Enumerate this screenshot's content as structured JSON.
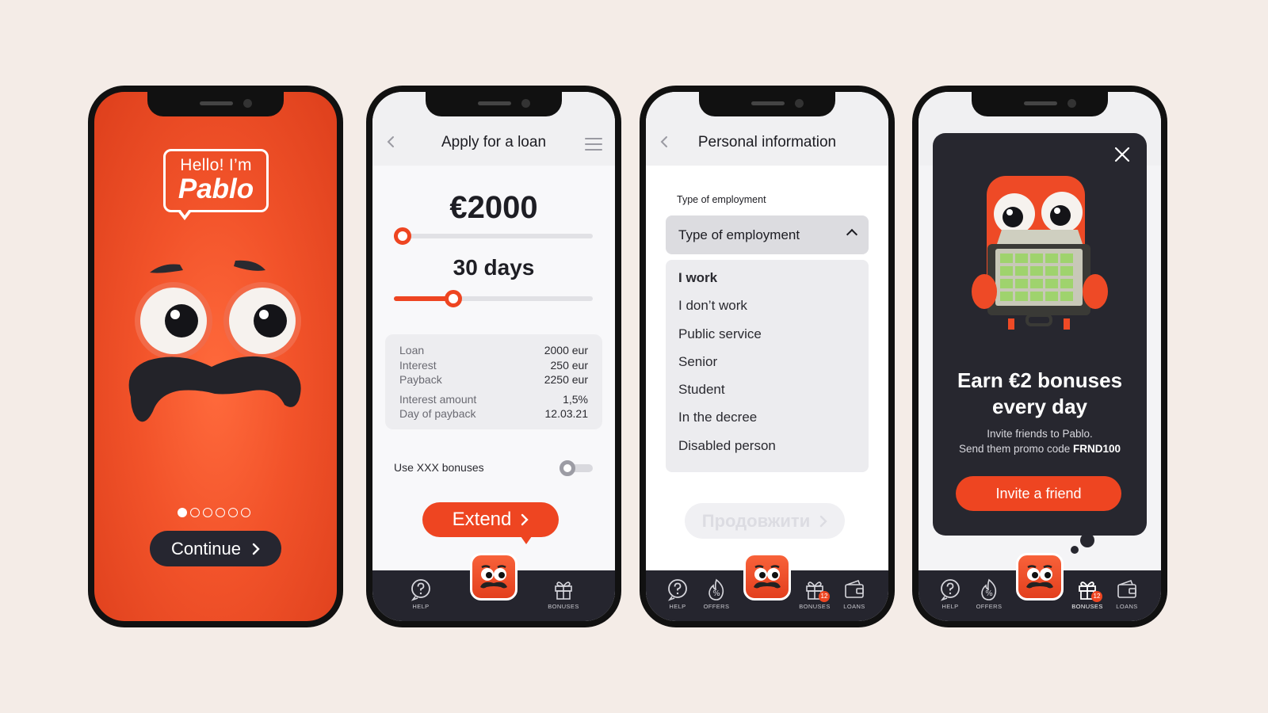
{
  "colors": {
    "background": "#f4ece7",
    "accent": "#ee4521",
    "dark": "#25252e"
  },
  "screen1": {
    "greeting_line1": "Hello! I’m",
    "greeting_line2": "Pablo",
    "pager": {
      "total": 6,
      "active": 1
    },
    "continue_label": "Continue"
  },
  "screen2": {
    "title": "Apply for a loan",
    "amount": "€2000",
    "amount_slider_fraction": 0.0,
    "days": "30 days",
    "days_slider_fraction": 0.28,
    "summary": [
      {
        "label": "Loan",
        "value": "2000 eur"
      },
      {
        "label": "Interest",
        "value": "250 eur"
      },
      {
        "label": "Payback",
        "value": "2250 eur"
      },
      {
        "label": "Interest amount",
        "value": "1,5%"
      },
      {
        "label": "Day of payback",
        "value": "12.03.21"
      }
    ],
    "bonus_toggle_label": "Use XXX bonuses",
    "bonus_toggle_on": false,
    "extend_label": "Extend",
    "tabs": {
      "help": "HELP",
      "bonuses": "BONUSES"
    }
  },
  "screen3": {
    "title": "Personal information",
    "field_label": "Type of employment",
    "select_value": "Type of employment",
    "options": [
      "I work",
      "I don’t work",
      "Public service",
      "Senior",
      "Student",
      "In the decree",
      "Disabled person"
    ],
    "selected_option": "I work",
    "next_label": "Продовжити",
    "tabs": {
      "help": "HELP",
      "offers": "OFFERS",
      "bonuses": "BONUSES",
      "loans": "LOANS"
    },
    "bonus_badge": "12"
  },
  "screen4": {
    "headline": "Earn €2 bonuses every day",
    "sub_line1": "Invite friends to Pablo.",
    "sub_line2_prefix": "Send them promo code ",
    "promo_code": "FRND100",
    "invite_label": "Invite a friend",
    "tabs": {
      "help": "HELP",
      "offers": "OFFERS",
      "bonuses": "BONUSES",
      "loans": "LOANS"
    },
    "bonus_badge": "12"
  }
}
